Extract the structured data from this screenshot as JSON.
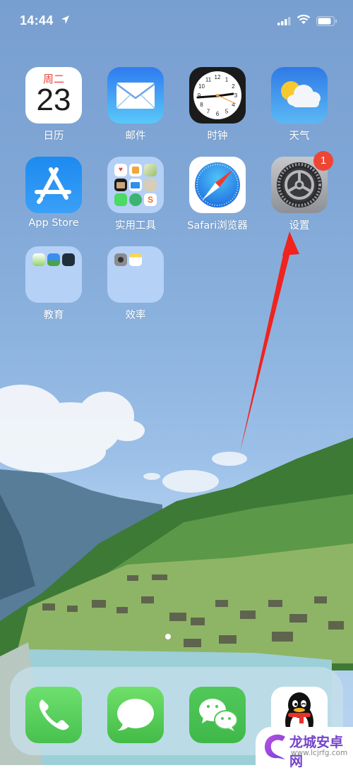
{
  "status_bar": {
    "time": "14:44",
    "location_icon": "location-arrow-icon",
    "signal_icon": "cellular-signal-icon",
    "wifi_icon": "wifi-icon",
    "battery_icon": "battery-icon"
  },
  "home_apps": [
    {
      "label": "日历",
      "icon": "calendar-icon",
      "weekday": "周二",
      "day": "23"
    },
    {
      "label": "邮件",
      "icon": "mail-icon"
    },
    {
      "label": "时钟",
      "icon": "clock-icon",
      "dial_numbers": [
        "12",
        "1",
        "2",
        "3",
        "4",
        "5",
        "6",
        "7",
        "8",
        "9",
        "10",
        "11"
      ]
    },
    {
      "label": "天气",
      "icon": "weather-icon"
    },
    {
      "label": "App Store",
      "icon": "app-store-icon"
    },
    {
      "label": "实用工具",
      "icon": "utilities-folder-icon"
    },
    {
      "label": "Safari浏览器",
      "icon": "safari-icon"
    },
    {
      "label": "设置",
      "icon": "settings-gear-icon",
      "badge": "1"
    },
    {
      "label": "教育",
      "icon": "education-folder-icon"
    },
    {
      "label": "效率",
      "icon": "productivity-folder-icon"
    }
  ],
  "page_indicator": {
    "pages": 1,
    "current": 1
  },
  "dock": [
    {
      "name": "phone",
      "icon": "phone-icon"
    },
    {
      "name": "messages",
      "icon": "messages-icon"
    },
    {
      "name": "wechat",
      "icon": "wechat-icon"
    },
    {
      "name": "qq",
      "icon": "qq-penguin-icon"
    }
  ],
  "annotation": {
    "type": "arrow",
    "color": "#f0231e",
    "points_to": "设置"
  },
  "watermark": {
    "title": "龙城安卓网",
    "url": "www.lcjrfg.com"
  },
  "colors": {
    "badge": "#ef4535",
    "dock_green": "#4cd964",
    "watermark": "#7443c9"
  }
}
